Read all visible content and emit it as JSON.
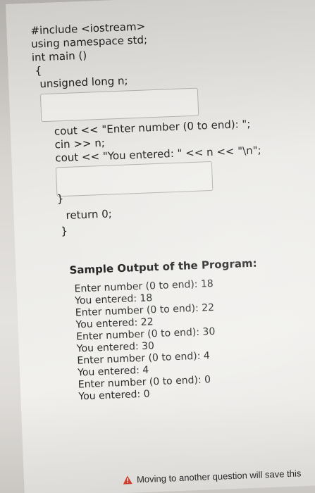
{
  "code_lines": [
    "#include <iostream>",
    "using namespace std;",
    "int main ()",
    "{",
    "unsigned long n;",
    "cout << \"Enter number (0 to end): \";",
    "cin >> n;",
    "cout << \"You entered: \" << n << \"\\n\";",
    "}",
    "return 0;",
    "}"
  ],
  "sample_heading": "Sample Output of the Program:",
  "sample_output": [
    "Enter number (0 to end): 18",
    "You entered: 18",
    "Enter number (0 to end): 22",
    "You entered: 22",
    "Enter number (0 to end): 30",
    "You entered: 30",
    "Enter number (0 to end): 4",
    "You entered: 4",
    "Enter number (0 to end): 0",
    "You entered: 0"
  ],
  "footer_notice": "Moving to another question will save this",
  "icons": {
    "warning": "warning-icon"
  },
  "colors": {
    "warning_fill": "#d7442f",
    "text": "#1f1f1f"
  }
}
